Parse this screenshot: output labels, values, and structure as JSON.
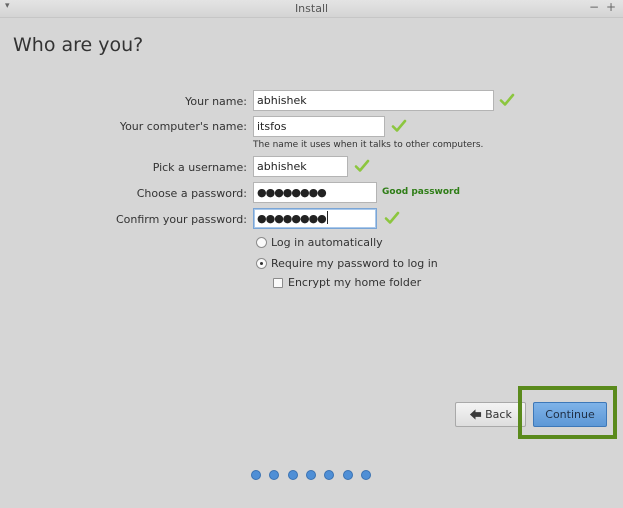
{
  "window": {
    "title": "Install",
    "menu_glyph": "▾",
    "minimize_glyph": "−",
    "maximize_glyph": "+"
  },
  "page": {
    "heading": "Who are you?"
  },
  "form": {
    "name": {
      "label": "Your name:",
      "value": "abhishek"
    },
    "computer_name": {
      "label": "Your computer's name:",
      "value": "itsfos",
      "hint": "The name it uses when it talks to other computers."
    },
    "username": {
      "label": "Pick a username:",
      "value": "abhishek"
    },
    "password": {
      "label": "Choose a password:",
      "value": "●●●●●●●●",
      "strength": "Good password"
    },
    "confirm_password": {
      "label": "Confirm your password:",
      "value": "●●●●●●●●"
    },
    "login_options": [
      {
        "label": "Log in automatically",
        "selected": false
      },
      {
        "label": "Require my password to log in",
        "selected": true
      }
    ],
    "encrypt_home": {
      "label": "Encrypt my home folder",
      "checked": false
    }
  },
  "buttons": {
    "back": "Back",
    "continue": "Continue"
  },
  "progress": {
    "total_steps": 7
  },
  "colors": {
    "valid_check": "#8cc63f",
    "strength_text": "#2e7d16",
    "continue_button": "#5d98d6",
    "highlight_box": "#5a8a1c",
    "progress_dot": "#4f8fd6"
  }
}
